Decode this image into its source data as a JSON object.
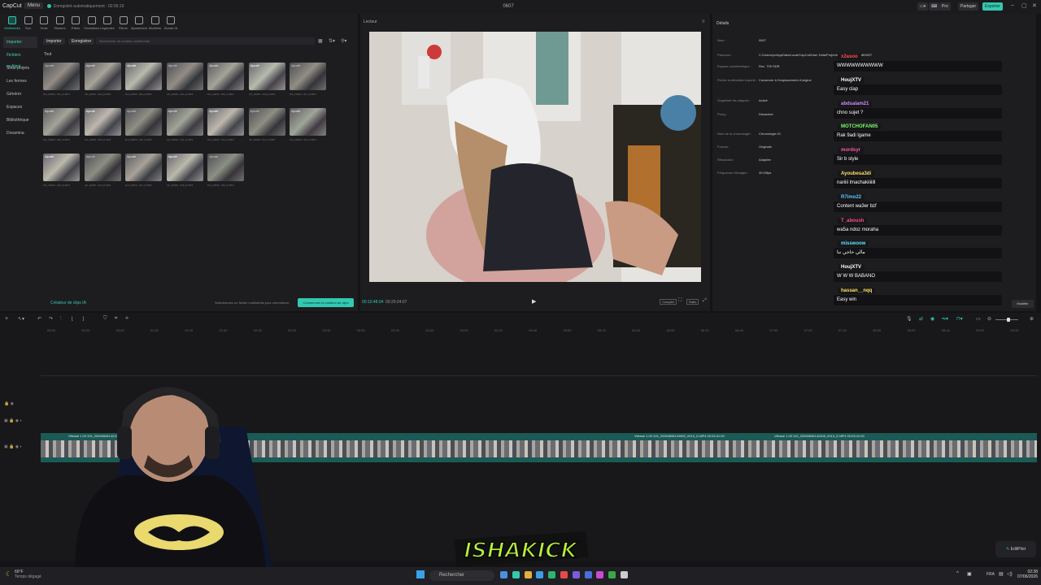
{
  "titlebar": {
    "app_name": "CapCut",
    "menu": "Menu",
    "autosave": "Enregistré automatiquement : 02:06:19",
    "project_title": "0607",
    "pro": "Pro",
    "share": "Partager",
    "export": "Exporter"
  },
  "toolbar": [
    {
      "label": "Multimédia",
      "icon": "media-icon"
    },
    {
      "label": "Son",
      "icon": "audio-icon"
    },
    {
      "label": "Texte",
      "icon": "text-icon"
    },
    {
      "label": "Stickers",
      "icon": "sticker-icon"
    },
    {
      "label": "Effets",
      "icon": "effects-icon"
    },
    {
      "label": "Transitions",
      "icon": "transitions-icon"
    },
    {
      "label": "Légendes",
      "icon": "captions-icon"
    },
    {
      "label": "Filtres",
      "icon": "filters-icon"
    },
    {
      "label": "Ajustement",
      "icon": "adjust-icon"
    },
    {
      "label": "Modèles",
      "icon": "templates-icon"
    },
    {
      "label": "Avatar IA",
      "icon": "avatar-icon"
    }
  ],
  "sidebar": [
    "Importer",
    "Fichiers multimé...",
    "Sous-projets",
    "Les fermes",
    "Générer",
    "Espaces",
    "Bibliothèque",
    "Dreamina"
  ],
  "media": {
    "import": "Importer",
    "record": "Enregistrer",
    "search_placeholder": "Rechercher du contenu multimédia",
    "folder": "Tout",
    "added_tag": "Ajouté",
    "clips": [
      "DJI_20260...001_D.MP4",
      "DJI_20260...002_D.MP4",
      "DJI_20260...003_D.MP4",
      "DJI_20260...004_D.MP4",
      "DJI_20260...005_D.MP4",
      "DJI_20260...006_D.MP4",
      "DJI_20260...007_D.MP4",
      "DJI_20260...008_D.MP4",
      "DJI_20260...009_D.MP4",
      "DJI_20260...010_D.MP4",
      "DJI_20260...011_D.MP4",
      "DJI_20260...012_D.MP4",
      "DJI_20260...013_D.MP4",
      "DJI_20260...014_D.MP4",
      "DJI_20260...015_D.MP4",
      "DJI_20260...016_D.MP4",
      "DJI_20260...017_D.MP4",
      "DJI_20260...018_D.MP4",
      "DJI_20260...019_D.MP4"
    ],
    "ai_clip": "Créateur de clips IA",
    "hint": "Sélectionnez un fichier multimédia pour commencer",
    "start": "Commencer la création de clips"
  },
  "player": {
    "title": "Lecteur",
    "current_time": "00:10:48:04",
    "total_time": "00:20:24:07",
    "btn_full": "Complet",
    "btn_ratio": "Ratio"
  },
  "details": {
    "title": "Détails",
    "rows": [
      {
        "label": "Nom :",
        "value": "0607"
      },
      {
        "label": "Parcours :",
        "value": "C:/Users/pc/AppData/Local/CapCut/User Data/Projects/com.lveditor.draft/0607"
      },
      {
        "label": "Espace colorimétrique :",
        "value": "Rec. 709 SDR"
      },
      {
        "label": "Fichier multimédia importé :",
        "value": "Conserver à l'emplacement d'origine"
      },
      {
        "label": "Organiser les calques :",
        "value": "Activé"
      },
      {
        "label": "Proxy :",
        "value": "Désactivé"
      },
      {
        "label": "Nom de la chronologie :",
        "value": "Chronologie 01"
      },
      {
        "label": "Format :",
        "value": "Originale"
      },
      {
        "label": "Résolution :",
        "value": "Adaptée"
      },
      {
        "label": "Fréquence d'images :",
        "value": "30.00fps"
      }
    ],
    "modify": "Modifier"
  },
  "chat": [
    {
      "user": "x2asoo",
      "color": "#ff4d4d",
      "message": "WWWWWWWWWW"
    },
    {
      "user": "HoujXTV",
      "color": "#ffffff",
      "message": "Easy clap"
    },
    {
      "user": "abdsalam21",
      "color": "#d28cff",
      "message": "chno sujet ?"
    },
    {
      "user": "MOTCHOFAN05",
      "color": "#7dff6b",
      "message": "Rak 9adi lgame"
    },
    {
      "user": "mordsyr",
      "color": "#ff5ca8",
      "message": "Sir b style"
    },
    {
      "user": "Ayoubesa3di",
      "color": "#ffe066",
      "message": "nariiii lmachakiiiiill"
    },
    {
      "user": "R7imo22",
      "color": "#5ec8ff",
      "message": "Content wa3er bzf"
    },
    {
      "user": "T_aboush",
      "color": "#ff4d8b",
      "message": "wa5a ndoz moraha"
    },
    {
      "user": "misswoow",
      "color": "#5ee6ff",
      "message": "مالي حاجي ننا"
    },
    {
      "user": "HoujXTV",
      "color": "#ffffff",
      "message": "W W W BABANO"
    },
    {
      "user": "hassan__nqq",
      "color": "#ffe066",
      "message": "Easy win"
    }
  ],
  "timeline": {
    "ticks": [
      "00:00",
      "00:20",
      "00:40",
      "01:00",
      "01:20",
      "01:40",
      "02:00",
      "02:20",
      "02:40",
      "03:00",
      "03:20",
      "03:40",
      "04:00",
      "04:20",
      "04:40",
      "05:00",
      "05:20",
      "05:40",
      "06:00",
      "06:20",
      "06:40",
      "07:00",
      "07:20",
      "07:40",
      "08:00",
      "08:20",
      "08:40",
      "09:00",
      "09:20",
      "09:40"
    ],
    "clip_labels": [
      "Vitesse 1.0X  DJI_20260606142135...",
      "Vitesse 1.0X  DJI_20260606142652_0013_D.MP4  00:03:41:00",
      "Vitesse 1.0X  DJI_20260606142408_0013_D.MP4  00:03:41:00"
    ]
  },
  "overlay": {
    "brand": "ISHAKICK",
    "edit_pilot": "EditPilot"
  },
  "taskbar": {
    "weather_temp": "66°F",
    "weather_text": "Temps dégagé",
    "search": "Rechercher",
    "lang": "FRA",
    "time": "02:38",
    "date": "07/06/2026"
  },
  "colors": {
    "accent": "#33c9b0",
    "panel": "#1d1d20",
    "background": "#141416"
  }
}
